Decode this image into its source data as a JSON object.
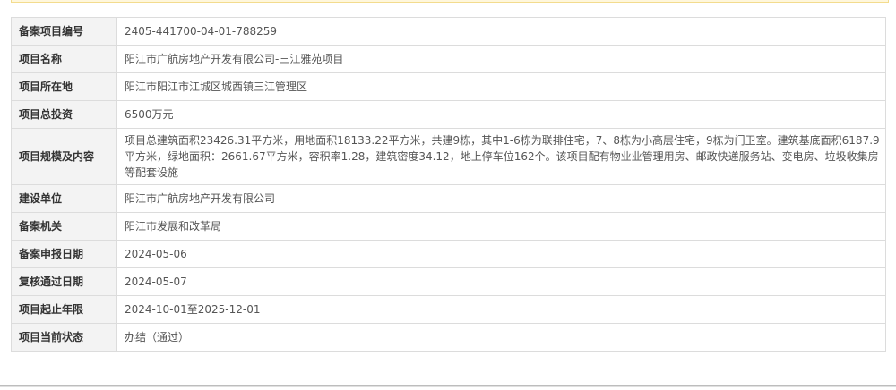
{
  "record": {
    "rows": [
      {
        "label": "备案项目编号",
        "value": "2405-441700-04-01-788259"
      },
      {
        "label": "项目名称",
        "value": "阳江市广航房地产开发有限公司-三江雅苑项目"
      },
      {
        "label": "项目所在地",
        "value": "阳江市阳江市江城区城西镇三江管理区"
      },
      {
        "label": "项目总投资",
        "value": "6500万元"
      },
      {
        "label": "项目规模及内容",
        "value": "项目总建筑面积23426.31平方米，用地面积18133.22平方米，共建9栋，其中1-6栋为联排住宅，7、8栋为小高层住宅，9栋为门卫室。建筑基底面积6187.9平方米，绿地面积：2661.67平方米，容积率1.28，建筑密度34.12，地上停车位162个。该项目配有物业业管理用房、邮政快递服务站、变电房、垃圾收集房等配套设施"
      },
      {
        "label": "建设单位",
        "value": "阳江市广航房地产开发有限公司"
      },
      {
        "label": "备案机关",
        "value": "阳江市发展和改革局"
      },
      {
        "label": "备案申报日期",
        "value": "2024-05-06"
      },
      {
        "label": "复核通过日期",
        "value": "2024-05-07"
      },
      {
        "label": "项目起止年限",
        "value": "2024-10-01至2025-12-01"
      },
      {
        "label": "项目当前状态",
        "value": "办结（通过）"
      }
    ]
  },
  "colors": {
    "label_bg": "#f3f3f3",
    "border": "#dcdcdc",
    "notice_bg": "#fff7dc",
    "notice_border": "#f3dc8e"
  }
}
